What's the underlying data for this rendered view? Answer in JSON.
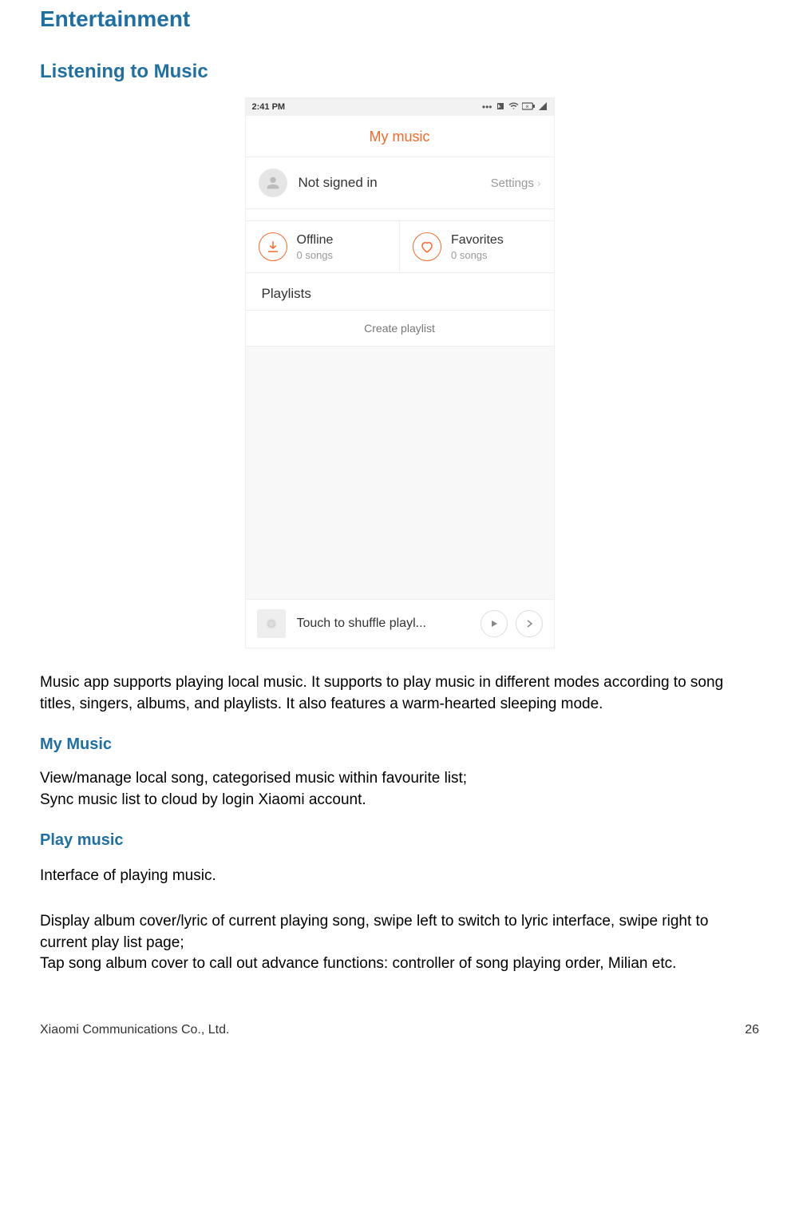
{
  "headings": {
    "h1": "Entertainment",
    "h2": "Listening to Music",
    "h3_mymusic": "My Music",
    "h3_playmusic": "Play music"
  },
  "screenshot": {
    "status_time": "2:41 PM",
    "app_title": "My music",
    "profile_name": "Not signed in",
    "settings_label": "Settings",
    "offline": {
      "label": "Offline",
      "sub": "0 songs"
    },
    "favorites": {
      "label": "Favorites",
      "sub": "0 songs"
    },
    "playlists_title": "Playlists",
    "create_playlist": "Create playlist",
    "now_playing_text": "Touch to shuffle playl..."
  },
  "body": {
    "intro": "Music app supports playing local music. It supports to play music in different modes according to song titles, singers, albums, and playlists. It also features a warm-hearted sleeping mode.",
    "mymusic_p1": "View/manage local song, categorised music within favourite list;",
    "mymusic_p2": "Sync music list to cloud by login Xiaomi account.",
    "playmusic_p1": "Interface of playing music.",
    "playmusic_p2": "Display album cover/lyric of current playing song, swipe left to switch to lyric interface, swipe right to current play list page;",
    "playmusic_p3": "Tap song album cover to call out advance functions: controller of song playing order, Milian etc."
  },
  "footer": {
    "company": "Xiaomi Communications Co., Ltd.",
    "page": "26"
  }
}
